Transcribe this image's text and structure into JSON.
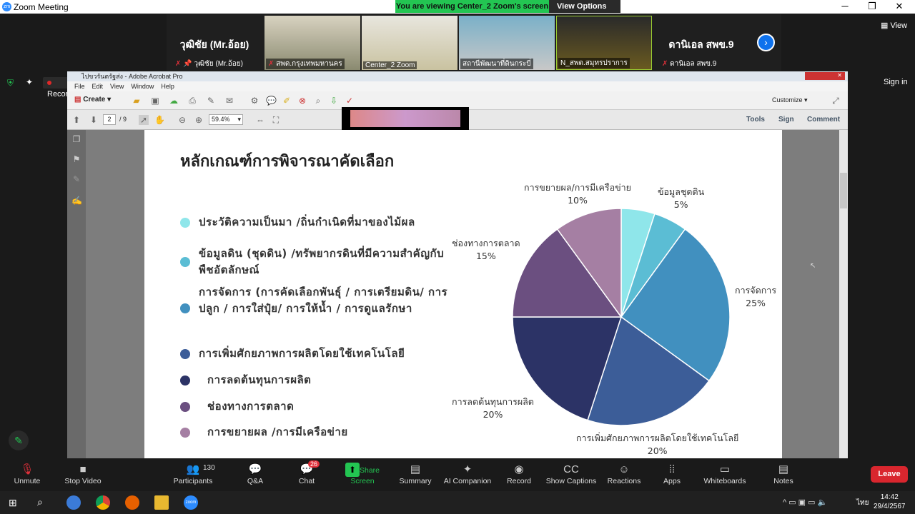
{
  "window": {
    "title": "Zoom Meeting",
    "minimize": "─",
    "maximize": "❐",
    "close": "✕"
  },
  "share_banner": {
    "text": "You are viewing Center_2 Zoom's screen",
    "view_options": "View Options"
  },
  "gallery": {
    "left_name": "วุฒิชัย (Mr.อ้อย)",
    "left_label": "วุฒิชัย (Mr.อ้อย)",
    "tiles": [
      "สพด.กรุงเทพมหานคร",
      "Center_2 Zoom",
      "สถานีพัฒนาที่ดินกระบี่",
      "N_สพด.สมุทรปราการ"
    ],
    "right_name": "ดานิเอล สพข.9",
    "right_label": "ดานิเอล สพข.9"
  },
  "view_label": "View",
  "sign_in": "Sign in",
  "recording": "Recording",
  "acrobat": {
    "title": "ไปขวรันตรัฐส่ง - Adobe Acrobat Pro",
    "menu": [
      "File",
      "Edit",
      "View",
      "Window",
      "Help"
    ],
    "create": "Create",
    "customize": "Customize",
    "page_current": "2",
    "page_total": "/ 9",
    "zoom": "59.4%",
    "right_tabs": [
      "Tools",
      "Sign",
      "Comment"
    ]
  },
  "slide": {
    "title": "หลักเกณฑ์การพิจารณาคัดเลือก",
    "bullets": [
      {
        "text": "ประวัติความเป็นมา /ถิ่นกำเนิดที่มาของไม้ผล",
        "color": "#8fe6ea"
      },
      {
        "text": "ข้อมูลดิน (ชุดดิน) /ทรัพยากรดินที่มีความสำคัญกับพืชอัตลักษณ์",
        "color": "#5bbdd4"
      },
      {
        "text": "การจัดการ (การคัดเลือกพันธุ์ / การเตรียมดิน/ การปลูก / การใส่ปุ๋ย/ การให้น้ำ / การดูแลรักษา",
        "color": "#4190bf"
      },
      {
        "text": "การเพิ่มศักยภาพการผลิตโดยใช้เทคโนโลยี",
        "color": "#3c5d98"
      },
      {
        "text": "การลดต้นทุนการผลิต",
        "color": "#2c3366"
      },
      {
        "text": "ช่องทางการตลาด",
        "color": "#6b4f80"
      },
      {
        "text": "การขยายผล /การมีเครือข่าย",
        "color": "#a57fa3"
      }
    ]
  },
  "chart_data": {
    "type": "pie",
    "slices": [
      {
        "label": "",
        "value": 5,
        "color": "#8fe6ea"
      },
      {
        "label": "ข้อมูลชุดดิน",
        "value": 5,
        "pct": "5%",
        "color": "#5bbdd4"
      },
      {
        "label": "การจัดการ",
        "value": 25,
        "pct": "25%",
        "color": "#4190bf"
      },
      {
        "label": "การเพิ่มศักยภาพการผลิตโดยใช้เทคโนโลยี",
        "value": 20,
        "pct": "20%",
        "color": "#3c5d98"
      },
      {
        "label": "การลดต้นทุนการผลิต",
        "value": 20,
        "pct": "20%",
        "color": "#2c3366"
      },
      {
        "label": "ช่องทางการตลาด",
        "value": 15,
        "pct": "15%",
        "color": "#6b4f80"
      },
      {
        "label": "การขยายผล/การมีเครือข่าย",
        "value": 10,
        "pct": "10%",
        "color": "#a57fa3"
      }
    ]
  },
  "toolbar": {
    "items": [
      {
        "label": "Unmute",
        "icon": "mic-off-icon"
      },
      {
        "label": "Stop Video",
        "icon": "video-icon"
      },
      {
        "label": "Participants",
        "icon": "participants-icon",
        "count": "130"
      },
      {
        "label": "Q&A",
        "icon": "qa-icon"
      },
      {
        "label": "Chat",
        "icon": "chat-icon",
        "badge": "26"
      },
      {
        "label": "Share Screen",
        "icon": "share-icon"
      },
      {
        "label": "Summary",
        "icon": "summary-icon"
      },
      {
        "label": "AI Companion",
        "icon": "ai-icon"
      },
      {
        "label": "Record",
        "icon": "record-icon"
      },
      {
        "label": "Show Captions",
        "icon": "cc-icon"
      },
      {
        "label": "Reactions",
        "icon": "reactions-icon"
      },
      {
        "label": "Apps",
        "icon": "apps-icon"
      },
      {
        "label": "Whiteboards",
        "icon": "whiteboard-icon"
      },
      {
        "label": "Notes",
        "icon": "notes-icon"
      }
    ],
    "leave": "Leave"
  },
  "taskbar": {
    "time": "14:42",
    "date": "29/4/2567",
    "lang": "ไทย"
  }
}
